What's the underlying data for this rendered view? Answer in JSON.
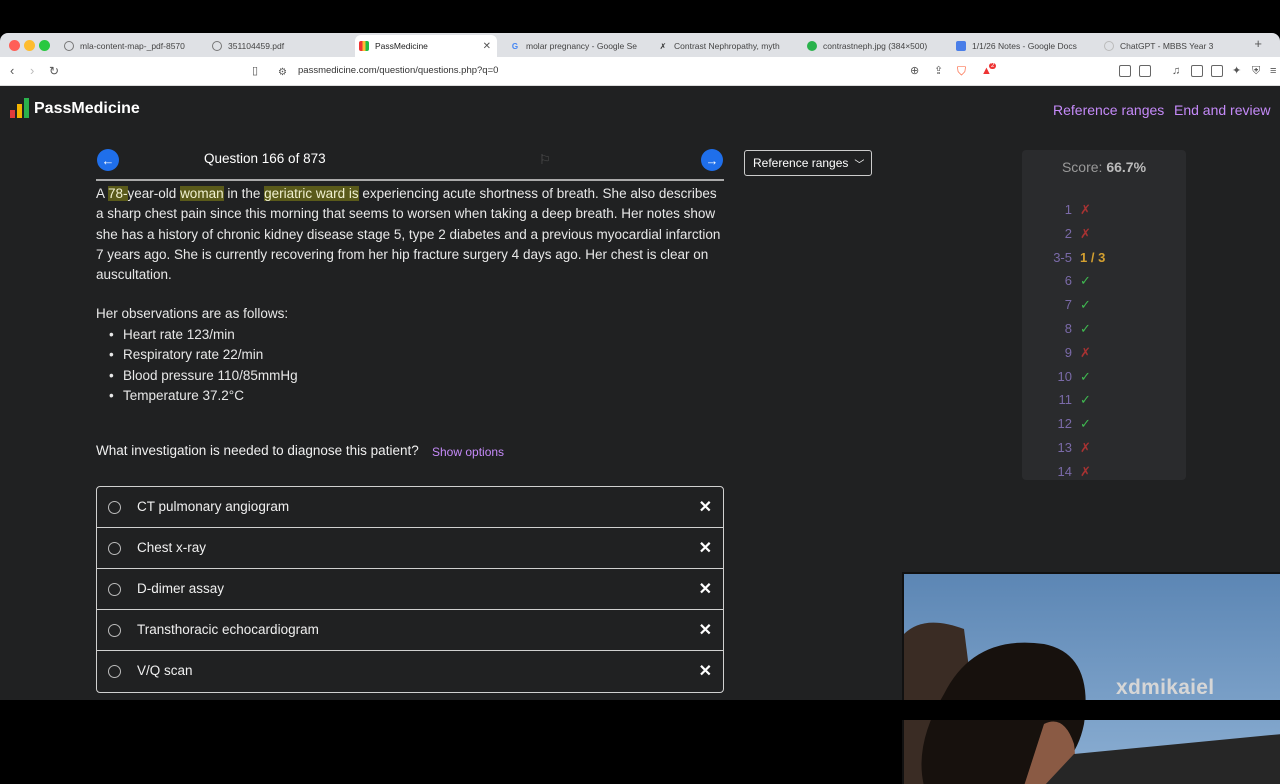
{
  "browser": {
    "tabs": [
      {
        "label": "mla-content-map-_pdf-8570",
        "icon": "globe-icon"
      },
      {
        "label": "351104459.pdf",
        "icon": "globe-icon"
      },
      {
        "label": "PassMedicine",
        "icon": "passmedicine-favicon",
        "active": true
      },
      {
        "label": "molar pregnancy - Google Se",
        "icon": "google-icon"
      },
      {
        "label": "Contrast Nephropathy, myth",
        "icon": "site-icon"
      },
      {
        "label": "contrastneph.jpg (384×500)",
        "icon": "image-icon"
      },
      {
        "label": "1/1/26 Notes - Google Docs",
        "icon": "docs-icon"
      },
      {
        "label": "ChatGPT - MBBS Year 3",
        "icon": "chatgpt-icon"
      }
    ],
    "url": "passmedicine.com/question/questions.php?q=0",
    "brave_badge": "2"
  },
  "header": {
    "brand": "PassMedicine",
    "links": [
      "Reference ranges",
      "End and review"
    ]
  },
  "question_nav": {
    "counter": "Question 166 of 873"
  },
  "stem": {
    "parts": [
      {
        "t": "A ",
        "h": false
      },
      {
        "t": "78-",
        "h": true
      },
      {
        "t": "year-old ",
        "h": false
      },
      {
        "t": "woman",
        "h": true
      },
      {
        "t": " in the ",
        "h": false
      },
      {
        "t": "geriatric ward is",
        "h": true
      },
      {
        "t": " experiencing acute shortness of breath. She also describes a sharp chest pain since this morning that seems to worsen when taking a deep breath. Her notes show she has a history of chronic kidney disease stage 5, type 2 diabetes and a previous myocardial infarction 7 years ago. She is currently recovering from her hip fracture surgery 4 days ago. Her chest is clear on auscultation.",
        "h": false
      }
    ]
  },
  "observations": {
    "title": "Her observations are as follows:",
    "items": [
      "Heart rate 123/min",
      "Respiratory rate 22/min",
      "Blood pressure 110/85mmHg",
      "Temperature 37.2°C"
    ]
  },
  "question": {
    "text": "What investigation is needed to diagnose this patient?",
    "show_options": "Show options"
  },
  "options": [
    "CT pulmonary angiogram",
    "Chest x-ray",
    "D-dimer assay",
    "Transthoracic echocardiogram",
    "V/Q scan"
  ],
  "reference_button": "Reference ranges",
  "score_panel": {
    "label": "Score:",
    "value": "66.7%",
    "rows": [
      {
        "num": "1",
        "mark": "✗",
        "status": "wrong"
      },
      {
        "num": "2",
        "mark": "✗",
        "status": "wrong"
      },
      {
        "num": "3-5",
        "mark": "1 / 3",
        "status": "partial"
      },
      {
        "num": "6",
        "mark": "✓",
        "status": "correct"
      },
      {
        "num": "7",
        "mark": "✓",
        "status": "correct"
      },
      {
        "num": "8",
        "mark": "✓",
        "status": "correct"
      },
      {
        "num": "9",
        "mark": "✗",
        "status": "wrong"
      },
      {
        "num": "10",
        "mark": "✓",
        "status": "correct"
      },
      {
        "num": "11",
        "mark": "✓",
        "status": "correct"
      },
      {
        "num": "12",
        "mark": "✓",
        "status": "correct"
      },
      {
        "num": "13",
        "mark": "✗",
        "status": "wrong"
      },
      {
        "num": "14",
        "mark": "✗",
        "status": "wrong"
      }
    ],
    "colors": {
      "correct": "#3fb950",
      "wrong": "#a83232",
      "partial": "#d4a030"
    }
  },
  "webcam": {
    "watermark": "xdmikaiel"
  }
}
